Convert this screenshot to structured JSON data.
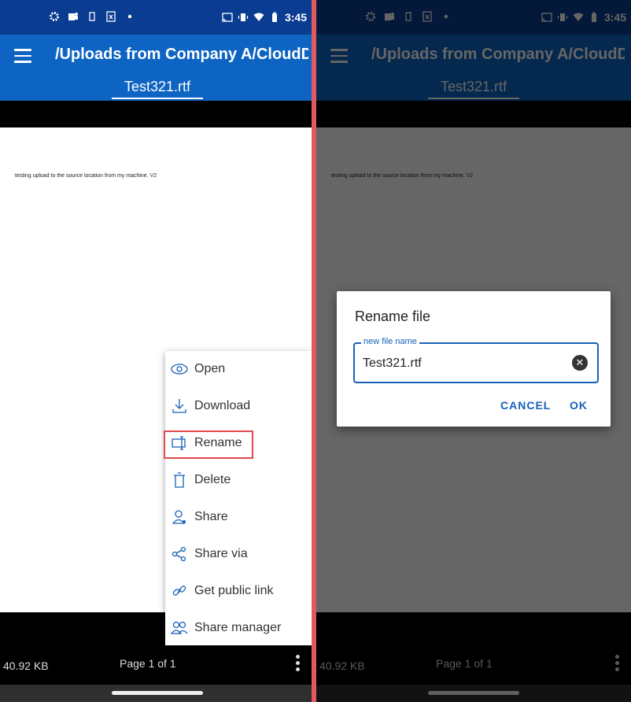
{
  "status": {
    "time": "3:45",
    "left_icons": [
      "settings-icon",
      "teams-icon",
      "device-icon",
      "excel-icon",
      "dot-icon"
    ],
    "right_icons": [
      "cast-icon",
      "vibrate-icon",
      "wifi-icon",
      "battery-icon"
    ]
  },
  "appbar": {
    "path_title": "/Uploads from Company A/CloudDr...",
    "tab": "Test321.rtf"
  },
  "document": {
    "text": "testing upload to the source location from my machine. V2"
  },
  "footer": {
    "size": "40.92 KB",
    "page": "Page 1 of 1"
  },
  "menu": {
    "items": [
      {
        "label": "Open",
        "icon": "eye-icon"
      },
      {
        "label": "Download",
        "icon": "download-icon"
      },
      {
        "label": "Rename",
        "icon": "rename-icon"
      },
      {
        "label": "Delete",
        "icon": "trash-icon"
      },
      {
        "label": "Share",
        "icon": "user-share-icon"
      },
      {
        "label": "Share via",
        "icon": "share-via-icon"
      },
      {
        "label": "Get public link",
        "icon": "link-icon"
      },
      {
        "label": "Share manager",
        "icon": "users-icon"
      }
    ]
  },
  "dialog": {
    "title": "Rename file",
    "field_label": "new file name",
    "field_value": "Test321.rtf",
    "cancel": "CANCEL",
    "ok": "OK"
  },
  "colors": {
    "status_bar": "#0a3d91",
    "app_bar": "#0d64c2",
    "accent": "#1561b8",
    "highlight": "#e14a4a"
  }
}
